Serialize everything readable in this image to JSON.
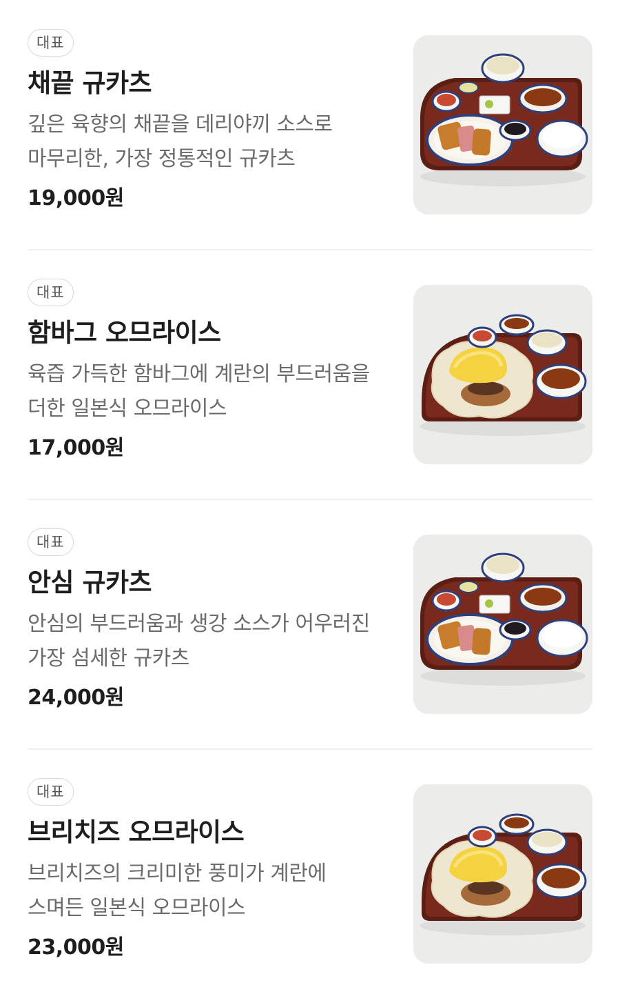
{
  "menu": {
    "items": [
      {
        "badge": "대표",
        "name": "채끝 규카츠",
        "description": "깊은 육향의 채끝을 데리야끼 소스로 마무리한, 가장 정통적인 규카츠",
        "price": "19,000원",
        "image": "gyukatsu-set-photo"
      },
      {
        "badge": "대표",
        "name": "함바그 오므라이스",
        "description": "육즙 가득한 함바그에 계란의 부드러움을 더한 일본식 오므라이스",
        "price": "17,000원",
        "image": "omurice-set-photo"
      },
      {
        "badge": "대표",
        "name": "안심 규카츠",
        "description": "안심의 부드러움과 생강 소스가 어우러진 가장 섬세한 규카츠",
        "price": "24,000원",
        "image": "gyukatsu-set-photo"
      },
      {
        "badge": "대표",
        "name": "브리치즈 오므라이스",
        "description": "브리치즈의 크리미한 풍미가 계란에 스며든 일본식 오므라이스",
        "price": "23,000원",
        "image": "omurice-set-photo"
      }
    ]
  }
}
